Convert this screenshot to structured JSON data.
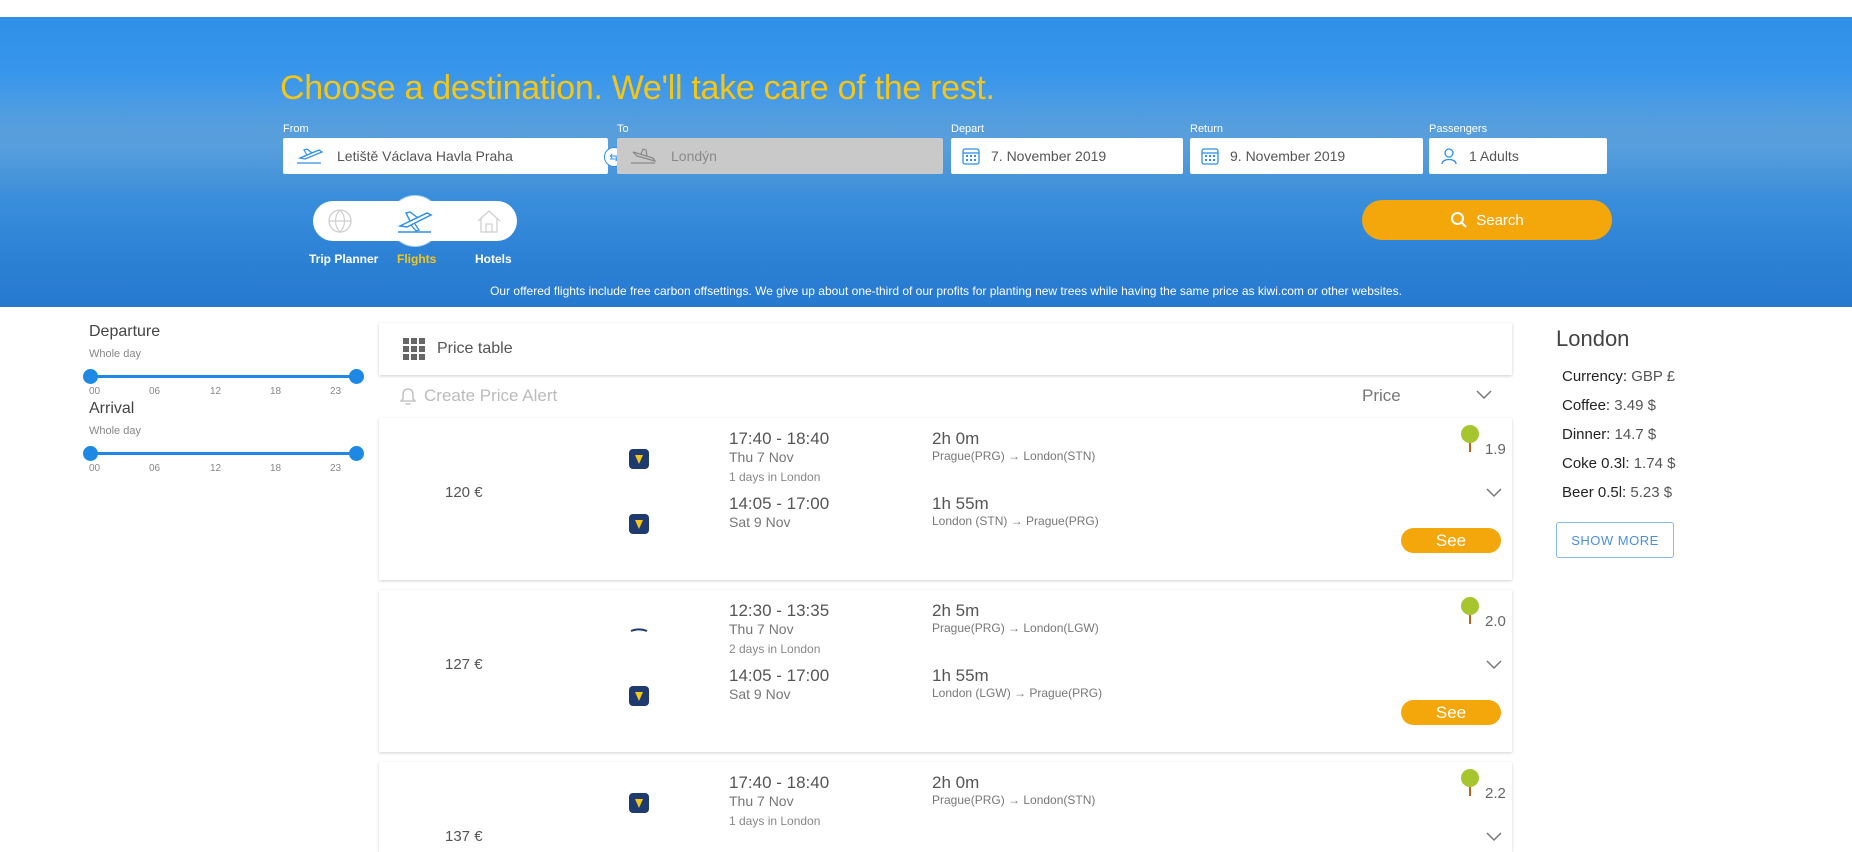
{
  "hero": {
    "headline": "Choose a destination. We'll take care of the rest.",
    "from_label": "From",
    "from_value": "Letiště Václava Havla Praha",
    "to_label": "To",
    "to_value": "Londýn",
    "depart_label": "Depart",
    "depart_value": "7. November 2019",
    "return_label": "Return",
    "return_value": "9. November 2019",
    "passengers_label": "Passengers",
    "passengers_value": "1 Adults",
    "search_label": "Search",
    "modes": [
      {
        "label": "Trip Planner",
        "icon": "globe-icon"
      },
      {
        "label": "Flights",
        "icon": "plane-icon",
        "active": true
      },
      {
        "label": "Hotels",
        "icon": "house-icon"
      }
    ],
    "carbon_note": "Our offered flights include free carbon offsettings. We give up about one-third of our profits for planting new trees while having the same price as kiwi.com or other websites."
  },
  "filters": {
    "departure_title": "Departure",
    "departure_sub": "Whole day",
    "arrival_title": "Arrival",
    "arrival_sub": "Whole day",
    "ticks": [
      "00",
      "06",
      "12",
      "18",
      "23"
    ]
  },
  "list": {
    "price_table_label": "Price table",
    "alert_label": "Create Price Alert",
    "sort_label": "Price",
    "see_label": "See",
    "results": [
      {
        "price": "120 €",
        "co2": "1.9",
        "out": {
          "times": "17:40 - 18:40",
          "date": "Thu 7 Nov",
          "dur": "2h 0m",
          "route": "Prague(PRG) → London(STN)"
        },
        "stay": "1 days in London",
        "back": {
          "times": "14:05 - 17:00",
          "date": "Sat 9 Nov",
          "dur": "1h 55m",
          "route": "London (STN) → Prague(PRG)"
        }
      },
      {
        "price": "127 €",
        "co2": "2.0",
        "out": {
          "times": "12:30 - 13:35",
          "date": "Thu 7 Nov",
          "dur": "2h 5m",
          "route": "Prague(PRG) → London(LGW)"
        },
        "stay": "2 days in London",
        "back": {
          "times": "14:05 - 17:00",
          "date": "Sat 9 Nov",
          "dur": "1h 55m",
          "route": "London (LGW) → Prague(PRG)"
        }
      },
      {
        "price": "137 €",
        "co2": "2.2",
        "out": {
          "times": "17:40 - 18:40",
          "date": "Thu 7 Nov",
          "dur": "2h 0m",
          "route": "Prague(PRG) → London(STN)"
        },
        "stay": "1 days in London"
      }
    ]
  },
  "city": {
    "name": "London",
    "stats": [
      {
        "label": "Currency:",
        "value": "GBP £"
      },
      {
        "label": "Coffee:",
        "value": "3.49 $"
      },
      {
        "label": "Dinner:",
        "value": "14.7 $"
      },
      {
        "label": "Coke 0.3l:",
        "value": "1.74 $"
      },
      {
        "label": "Beer 0.5l:",
        "value": "5.23 $"
      }
    ],
    "show_more": "SHOW MORE"
  },
  "colors": {
    "accent": "#f4a70b",
    "headline": "#f5c518",
    "slider": "#1e88e5",
    "hero": "#2f8fe8"
  }
}
